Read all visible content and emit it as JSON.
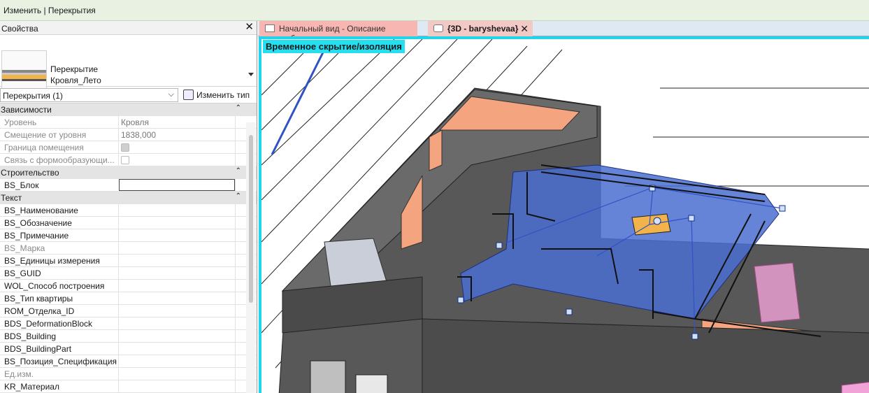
{
  "context_bar": {
    "title": "Изменить | Перекрытия"
  },
  "properties": {
    "title": "Свойства",
    "type_name_line1": "Перекрытие",
    "type_name_line2": "Кровля_Лето",
    "filter": "Перекрытия (1)",
    "edit_type": "Изменить тип",
    "groups": [
      {
        "label": "Зависимости",
        "rows": [
          {
            "label": "Уровень",
            "value": "Кровля"
          },
          {
            "label": "Смещение от уровня",
            "value": "1838,000"
          },
          {
            "label": "Граница помещения",
            "value": ""
          },
          {
            "label": "Связь с формообразующи...",
            "value": ""
          }
        ]
      },
      {
        "label": "Строительство",
        "rows": [
          {
            "label": "BS_Блок",
            "value": ""
          }
        ]
      },
      {
        "label": "Текст",
        "rows": [
          {
            "label": "BS_Наименование"
          },
          {
            "label": "BS_Обозначение"
          },
          {
            "label": "BS_Примечание"
          },
          {
            "label": "BS_Марка"
          },
          {
            "label": "BS_Единицы измерения"
          },
          {
            "label": "BS_GUID"
          },
          {
            "label": "WOL_Способ построения"
          },
          {
            "label": "BS_Тип квартиры"
          },
          {
            "label": "ROM_Отделка_ID"
          },
          {
            "label": "BDS_DeformationBlock"
          },
          {
            "label": "BDS_Building"
          },
          {
            "label": "BDS_BuildingPart"
          },
          {
            "label": "BS_Позиция_Спецификация"
          },
          {
            "label": "Ед.изм."
          },
          {
            "label": "KR_Материал"
          }
        ]
      }
    ]
  },
  "tabs": [
    {
      "label": "Начальный вид - Описание шабл..."
    },
    {
      "label": "{3D - baryshevaa}"
    }
  ],
  "viewport": {
    "banner": "Временное скрытие/изоляция"
  },
  "colors": {
    "accent_cyan": "#20d4ea",
    "selection_blue": "#4a6fd0",
    "wall_orange": "#f4a47f"
  }
}
